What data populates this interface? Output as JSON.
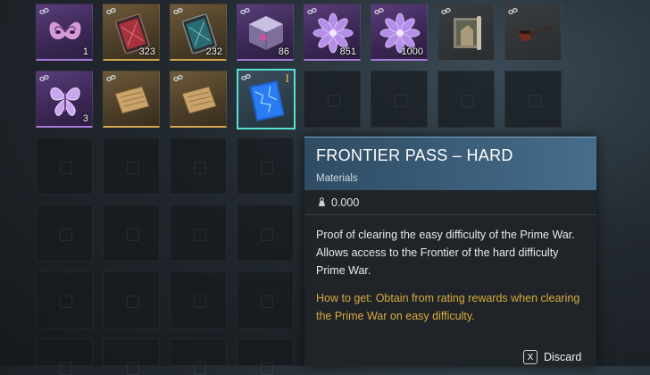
{
  "inventory": {
    "row1": [
      {
        "name": "butterfly-mask",
        "count": "1"
      },
      {
        "name": "red-card",
        "count": "323"
      },
      {
        "name": "teal-card",
        "count": "232"
      },
      {
        "name": "crystal-cube",
        "count": "86"
      },
      {
        "name": "violet-flower",
        "count": "851"
      },
      {
        "name": "violet-flower-2",
        "count": "1000"
      },
      {
        "name": "map-scroll",
        "count": ""
      },
      {
        "name": "pipe",
        "count": ""
      }
    ],
    "row2": [
      {
        "name": "butterfly",
        "count": "3"
      },
      {
        "name": "parchment-1",
        "count": ""
      },
      {
        "name": "parchment-2",
        "count": ""
      },
      {
        "name": "frontier-pass",
        "count": "",
        "marker": "I"
      }
    ]
  },
  "tooltip": {
    "title": "FRONTIER PASS – HARD",
    "category": "Materials",
    "weight": "0.000",
    "description": "Proof of clearing the easy difficulty of the Prime War. Allows access to the Frontier of the hard difficulty Prime War.",
    "how_to_get": "How to get: Obtain from rating rewards when clearing the Prime War on easy difficulty."
  },
  "actions": {
    "discard_key": "X",
    "discard_label": "Discard"
  },
  "colors": {
    "rarity_purple": "#a77bd6",
    "rarity_gold": "#d7a64d",
    "selected": "#53e0d6",
    "how_to_get": "#d8aa3e"
  }
}
